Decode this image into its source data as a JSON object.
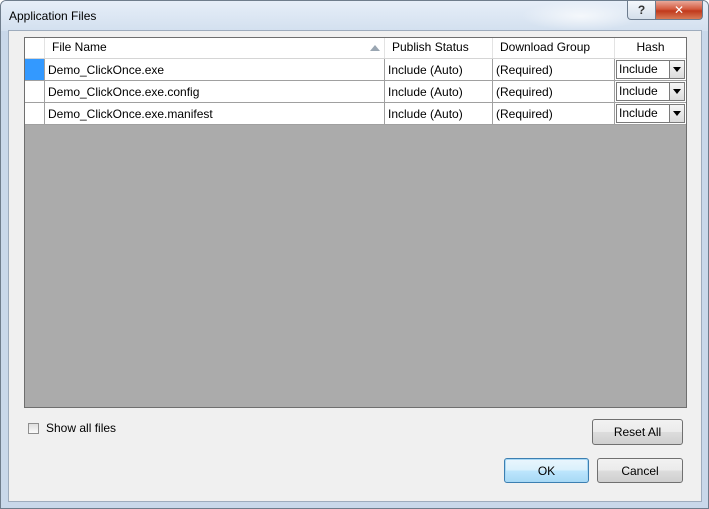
{
  "window": {
    "title": "Application Files",
    "help_label": "?",
    "close_label": "✕"
  },
  "grid": {
    "columns": [
      "File Name",
      "Publish Status",
      "Download Group",
      "Hash"
    ],
    "rows": [
      {
        "file": "Demo_ClickOnce.exe",
        "status": "Include (Auto)",
        "group": "(Required)",
        "hash": "Include"
      },
      {
        "file": "Demo_ClickOnce.exe.config",
        "status": "Include (Auto)",
        "group": "(Required)",
        "hash": "Include"
      },
      {
        "file": "Demo_ClickOnce.exe.manifest",
        "status": "Include (Auto)",
        "group": "(Required)",
        "hash": "Include"
      }
    ]
  },
  "options": {
    "show_all_label": "Show all files"
  },
  "buttons": {
    "reset": "Reset All",
    "ok": "OK",
    "cancel": "Cancel"
  },
  "colors": {
    "selection": "#3399ff",
    "grid_background": "#ababab"
  }
}
